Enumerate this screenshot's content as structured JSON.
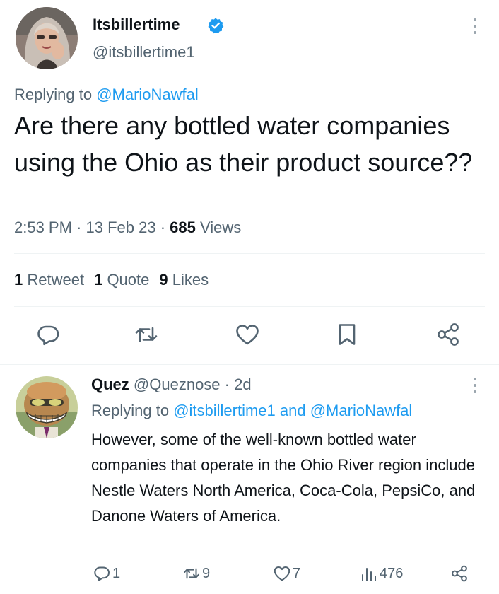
{
  "main_tweet": {
    "display_name": "Itsbillertime",
    "handle": "@itsbillertime1",
    "replying_prefix": "Replying to ",
    "replying_to": "@MarioNawfal",
    "text": "Are there any bottled water companies using the Ohio as their product source??",
    "time": "2:53 PM",
    "date": "13 Feb 23",
    "views_count": "685",
    "views_label": " Views",
    "dot": " · ",
    "stats": {
      "retweets_count": "1",
      "retweets_label": " Retweet",
      "quotes_count": "1",
      "quotes_label": " Quote",
      "likes_count": "9",
      "likes_label": " Likes"
    },
    "actions": [
      "reply-icon",
      "retweet-icon",
      "like-icon",
      "bookmark-icon",
      "share-icon"
    ]
  },
  "reply_tweet": {
    "display_name": "Quez",
    "handle": "@Queznose",
    "age": " · 2d",
    "replying_prefix": "Replying to ",
    "replying_to_1": "@itsbillertime1",
    "replying_and": " and ",
    "replying_to_2": "@MarioNawfal",
    "text": "However, some of the well-known bottled water companies that operate in the Ohio River region include Nestle Waters North America, Coca-Cola, PepsiCo, and Danone Waters of America.",
    "replies": "1",
    "retweets": "9",
    "likes": "7",
    "views": "476"
  },
  "colors": {
    "link": "#1d9bf0",
    "secondary_text": "#536471",
    "primary_text": "#0f1419",
    "divider": "#eff3f4"
  }
}
